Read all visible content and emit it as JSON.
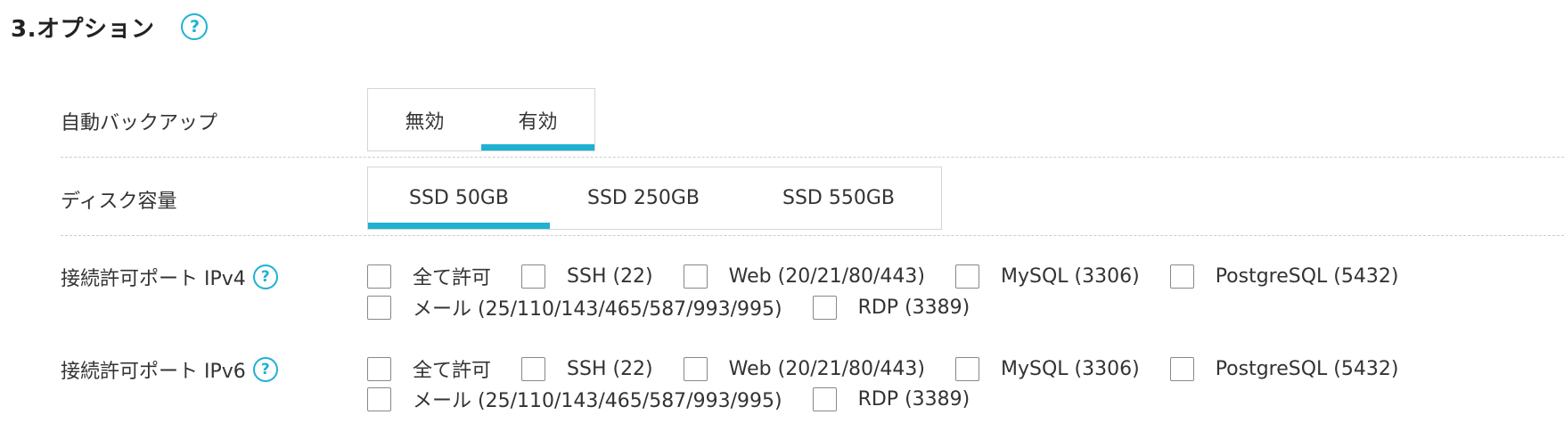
{
  "section": {
    "title": "3.オプション",
    "help_icon": "question-circle-icon"
  },
  "accent_color": "#1fb1d2",
  "auto_backup": {
    "label": "自動バックアップ",
    "options": [
      "無効",
      "有効"
    ],
    "selected": "有効"
  },
  "disk": {
    "label": "ディスク容量",
    "options": [
      "SSD 50GB",
      "SSD 250GB",
      "SSD 550GB"
    ],
    "selected": "SSD 50GB"
  },
  "ports_ipv4": {
    "label": "接続許可ポート IPv4",
    "options": [
      "全て許可",
      "SSH (22)",
      "Web (20/21/80/443)",
      "MySQL (3306)",
      "PostgreSQL (5432)",
      "メール (25/110/143/465/587/993/995)",
      "RDP (3389)"
    ]
  },
  "ports_ipv6": {
    "label": "接続許可ポート IPv6",
    "options": [
      "全て許可",
      "SSH (22)",
      "Web (20/21/80/443)",
      "MySQL (3306)",
      "PostgreSQL (5432)",
      "メール (25/110/143/465/587/993/995)",
      "RDP (3389)"
    ]
  }
}
